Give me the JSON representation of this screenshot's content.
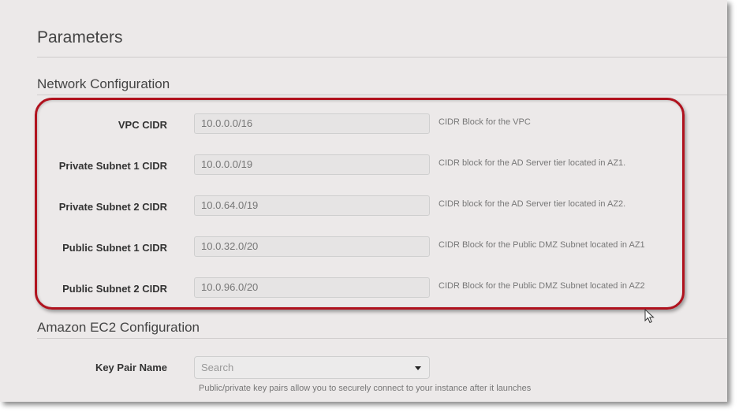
{
  "page": {
    "title": "Parameters"
  },
  "network": {
    "title": "Network Configuration",
    "rows": [
      {
        "label": "VPC CIDR",
        "value": "10.0.0.0/16",
        "help": "CIDR Block for the VPC"
      },
      {
        "label": "Private Subnet 1 CIDR",
        "value": "10.0.0.0/19",
        "help": "CIDR block for the AD Server tier located in AZ1."
      },
      {
        "label": "Private Subnet 2 CIDR",
        "value": "10.0.64.0/19",
        "help": "CIDR block for the AD Server tier located in AZ2."
      },
      {
        "label": "Public Subnet 1 CIDR",
        "value": "10.0.32.0/20",
        "help": "CIDR Block for the Public DMZ Subnet located in AZ1"
      },
      {
        "label": "Public Subnet 2 CIDR",
        "value": "10.0.96.0/20",
        "help": "CIDR Block for the Public DMZ Subnet located in AZ2"
      }
    ]
  },
  "ec2": {
    "title": "Amazon EC2 Configuration",
    "key_pair": {
      "label": "Key Pair Name",
      "placeholder": "Search",
      "help": "Public/private key pairs allow you to securely connect to your instance after it launches"
    }
  },
  "annotation": {
    "highlight_color": "#b0121e"
  }
}
